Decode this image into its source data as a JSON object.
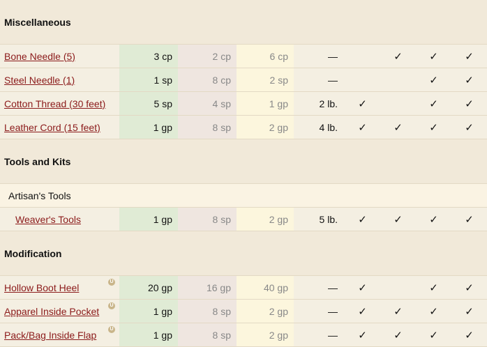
{
  "sections": [
    {
      "title": "Miscellaneous",
      "rows": [
        {
          "name": "Bone Needle (5)",
          "cost": "3 cp",
          "sell": "2 cp",
          "other": "6 cp",
          "weight": "—",
          "checks": [
            "",
            "✓",
            "✓",
            "✓"
          ],
          "badge": false
        },
        {
          "name": "Steel Needle (1)",
          "cost": "1 sp",
          "sell": "8 cp",
          "other": "2 sp",
          "weight": "—",
          "checks": [
            "",
            "",
            "✓",
            "✓"
          ],
          "badge": false
        },
        {
          "name": "Cotton Thread (30 feet)",
          "cost": "5 sp",
          "sell": "4 sp",
          "other": "1 gp",
          "weight": "2 lb.",
          "checks": [
            "✓",
            "",
            "✓",
            "✓"
          ],
          "badge": false
        },
        {
          "name": "Leather Cord (15 feet)",
          "cost": "1 gp",
          "sell": "8 sp",
          "other": "2 gp",
          "weight": "4 lb.",
          "checks": [
            "✓",
            "✓",
            "✓",
            "✓"
          ],
          "badge": false
        }
      ]
    },
    {
      "title": "Tools and Kits",
      "subsection": "Artisan's Tools",
      "rows": [
        {
          "name": "Weaver's Tools",
          "cost": "1 gp",
          "sell": "8 sp",
          "other": "2 gp",
          "weight": "5 lb.",
          "checks": [
            "✓",
            "✓",
            "✓",
            "✓"
          ],
          "badge": false,
          "indent": true
        }
      ]
    },
    {
      "title": "Modification",
      "rows": [
        {
          "name": "Hollow Boot Heel",
          "cost": "20 gp",
          "sell": "16 gp",
          "other": "40 gp",
          "weight": "—",
          "checks": [
            "✓",
            "",
            "✓",
            "✓"
          ],
          "badge": true
        },
        {
          "name": "Apparel Inside Pocket",
          "cost": "1 gp",
          "sell": "8 sp",
          "other": "2 gp",
          "weight": "—",
          "checks": [
            "✓",
            "✓",
            "✓",
            "✓"
          ],
          "badge": true
        },
        {
          "name": "Pack/Bag Inside Flap",
          "cost": "1 gp",
          "sell": "8 sp",
          "other": "2 gp",
          "weight": "—",
          "checks": [
            "✓",
            "✓",
            "✓",
            "✓"
          ],
          "badge": true
        }
      ]
    }
  ],
  "badge_glyph": "U"
}
